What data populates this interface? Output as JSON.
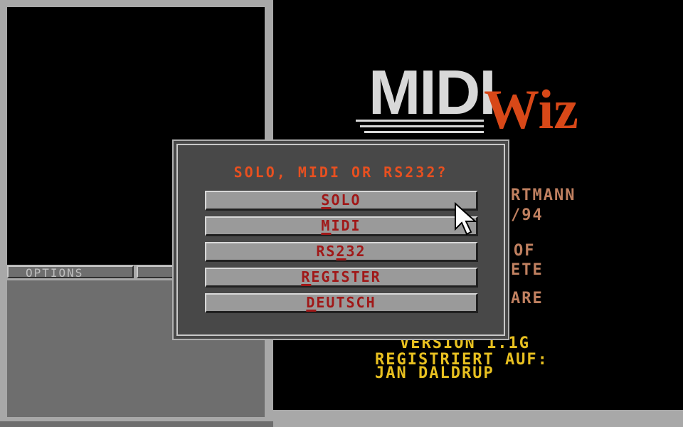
{
  "left_panel": {
    "options_tab_label": "OPTIONS"
  },
  "logo": {
    "midi": "MIDI",
    "wiz": "Wiz"
  },
  "background": {
    "line1": "RTMANN",
    "line2": "/94",
    "line3": "OF",
    "line4": "ETE",
    "line5": "ARE",
    "version": "VERSION 1.1G",
    "registered_label": "REGISTRIERT AUF:",
    "registered_name": "JAN DALDRUP"
  },
  "dialog": {
    "title": "SOLO, MIDI OR RS232?",
    "buttons": [
      {
        "pre": "",
        "ul": "S",
        "post": "OLO"
      },
      {
        "pre": "",
        "ul": "M",
        "post": "IDI"
      },
      {
        "pre": "RS",
        "ul": "2",
        "post": "32"
      },
      {
        "pre": "",
        "ul": "R",
        "post": "EGISTER"
      },
      {
        "pre": "",
        "ul": "D",
        "post": "EUTSCH"
      }
    ]
  },
  "colors": {
    "title_orange": "#e85020",
    "button_text_red": "#a01818",
    "bg_text_brown": "#c08060",
    "bg_text_yellow": "#e8c020"
  },
  "icons": {
    "cursor": "arrow-pointer-icon"
  }
}
